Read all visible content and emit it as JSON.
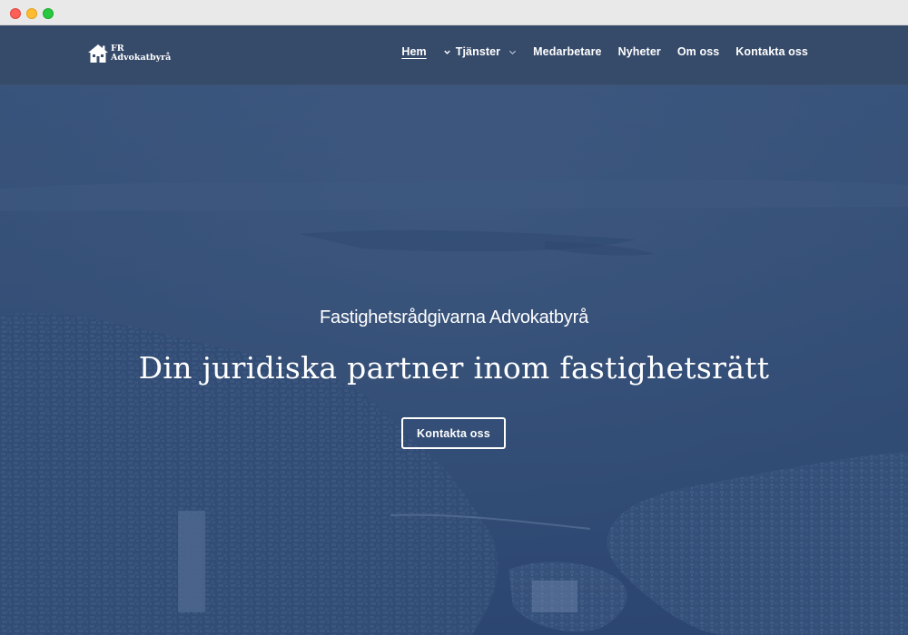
{
  "header": {
    "logo": {
      "line1": "FR",
      "line2": "Advokatbyrå",
      "icon": "house-icon"
    },
    "nav": [
      {
        "label": "Hem",
        "active": true
      },
      {
        "label": "Tjänster",
        "has_dropdown": true
      },
      {
        "label": "Medarbetare"
      },
      {
        "label": "Nyheter"
      },
      {
        "label": "Om oss"
      },
      {
        "label": "Kontakta oss"
      }
    ]
  },
  "hero": {
    "subtitle": "Fastighetsrådgivarna Advokatbyrå",
    "title": "Din juridiska partner inom fastighetsrätt",
    "cta_label": "Kontakta oss",
    "background": "aerial-city-coast-photo"
  },
  "colors": {
    "overlay": "#2f4a73",
    "header_bg": "#3a4d6b",
    "text": "#ffffff",
    "titlebar": "#e9e9e9"
  },
  "window_controls": [
    "close",
    "minimize",
    "maximize"
  ]
}
